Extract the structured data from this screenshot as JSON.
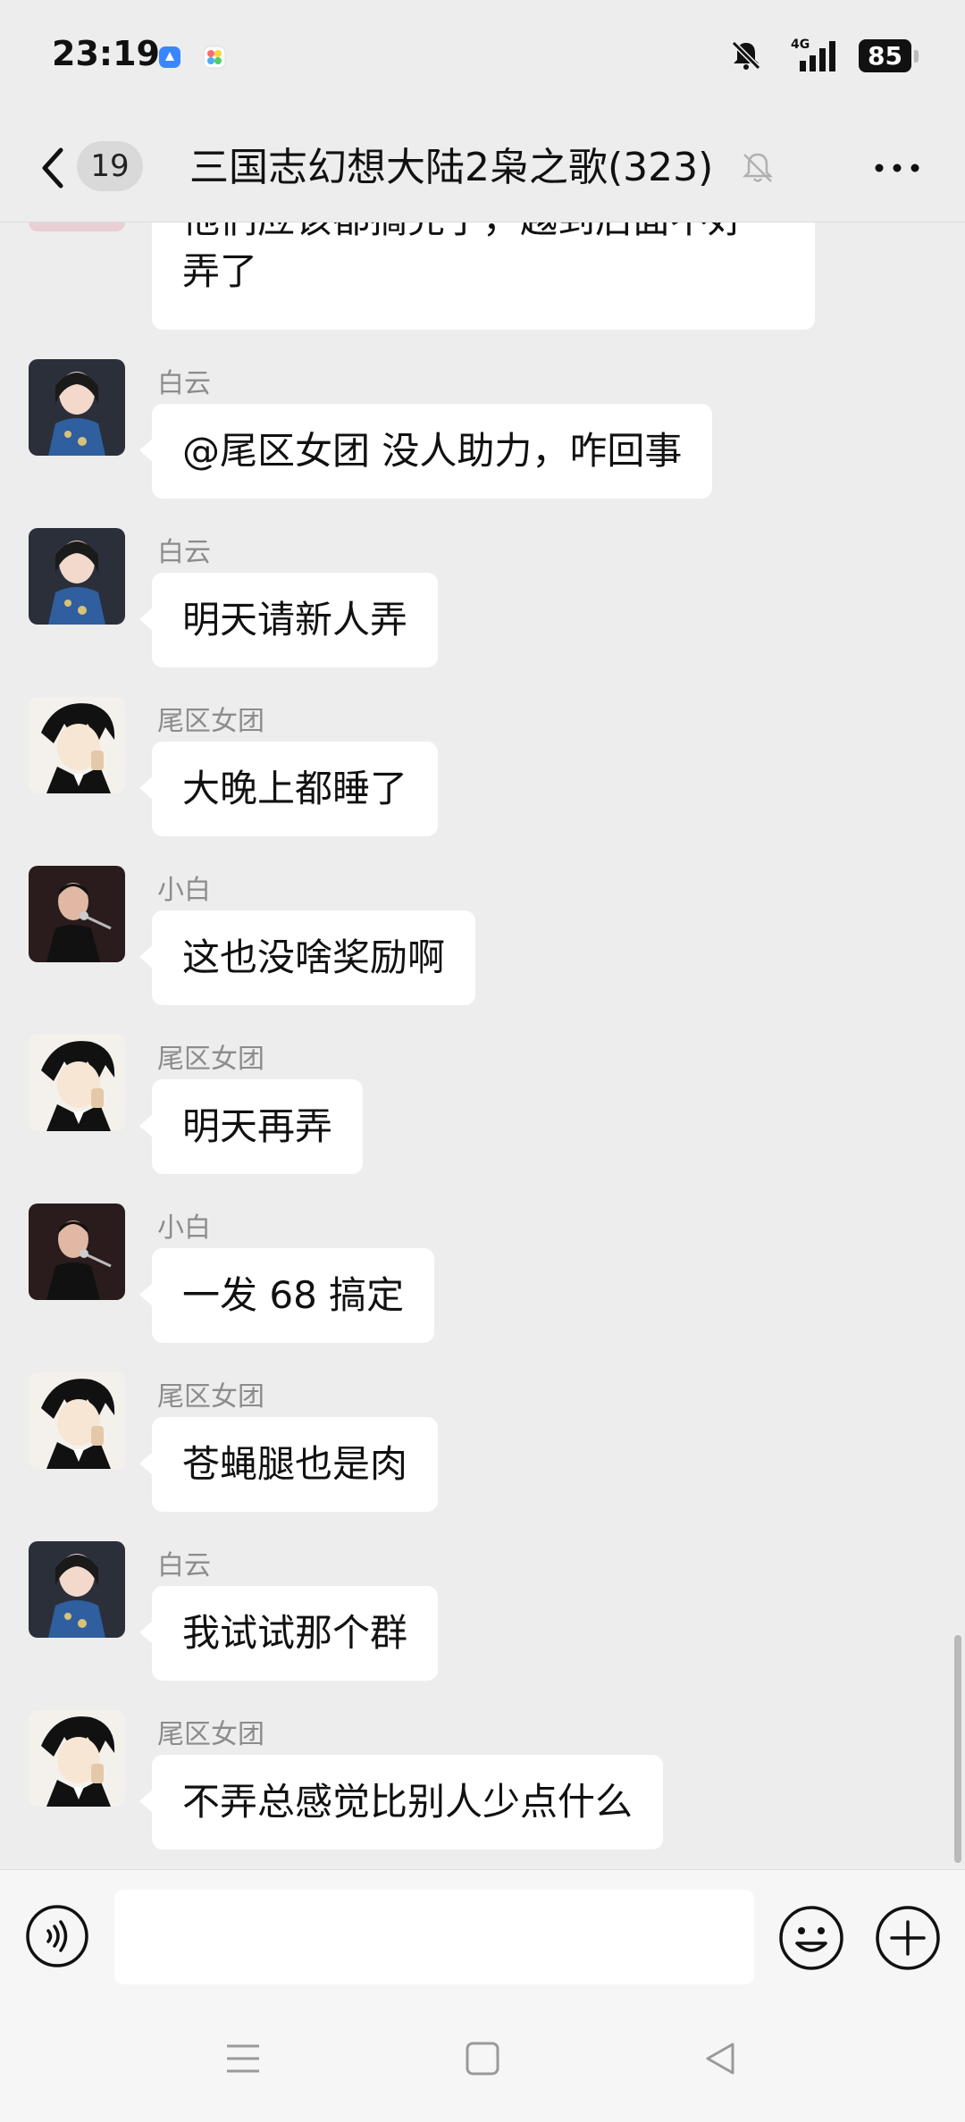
{
  "status_bar": {
    "time": "23:19",
    "network": "4G",
    "battery": "85",
    "icons": [
      "app-notification-icon",
      "colorful-app-icon",
      "bell-muted-icon",
      "signal-4g-icon",
      "battery-icon"
    ]
  },
  "header": {
    "unread_count": "19",
    "title": "三国志幻想大陆2枭之歌(323)",
    "icons": [
      "chevron-left-icon",
      "bell-muted-icon",
      "more-dots-icon"
    ]
  },
  "messages": [
    {
      "sender": "",
      "lines": [
        "他们应该都搞完了，越到后面不好",
        "弄了"
      ],
      "partial": true
    },
    {
      "sender": "白云",
      "text": "@尾区女团  没人助力，咋回事",
      "avatar": "woman-qipao"
    },
    {
      "sender": "白云",
      "text": "明天请新人弄",
      "avatar": "woman-qipao"
    },
    {
      "sender": "尾区女团",
      "text": "大晚上都睡了",
      "avatar": "anime-man"
    },
    {
      "sender": "小白",
      "text": "这也没啥奖励啊",
      "avatar": "singer"
    },
    {
      "sender": "尾区女团",
      "text": "明天再弄",
      "avatar": "anime-man"
    },
    {
      "sender": "小白",
      "text": "一发 68 搞定",
      "avatar": "singer"
    },
    {
      "sender": "尾区女团",
      "text": "苍蝇腿也是肉",
      "avatar": "anime-man"
    },
    {
      "sender": "白云",
      "text": "我试试那个群",
      "avatar": "woman-qipao"
    },
    {
      "sender": "尾区女团",
      "text": "不弄总感觉比别人少点什么",
      "avatar": "anime-man"
    }
  ],
  "input_bar": {
    "placeholder": "",
    "icons": [
      "voice-icon",
      "emoji-icon",
      "plus-icon"
    ]
  },
  "nav_bar": {
    "icons": [
      "menu-icon",
      "home-square-icon",
      "back-triangle-icon"
    ]
  },
  "colors": {
    "background": "#ededed",
    "bubble": "#ffffff",
    "sender_name": "#8c8c8c"
  }
}
